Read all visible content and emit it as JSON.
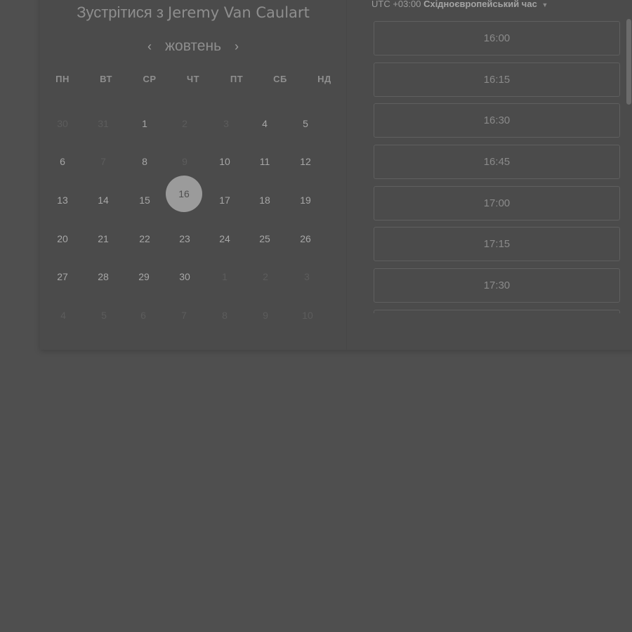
{
  "scheduler": {
    "title_prefix": "Зустрітися з",
    "host_name": "Jeremy Van Caulart",
    "month": "жовтень",
    "prev_icon": "‹",
    "next_icon": "›",
    "weekdays": [
      "ПН",
      "ВТ",
      "СР",
      "ЧТ",
      "ПТ",
      "СБ",
      "НД"
    ],
    "weeks": [
      [
        "30",
        "31",
        "1",
        "2",
        "3",
        "4",
        "5"
      ],
      [
        "6",
        "7",
        "8",
        "9",
        "10",
        "11",
        "12"
      ],
      [
        "13",
        "14",
        "15",
        "16",
        "17",
        "18",
        "19"
      ],
      [
        "20",
        "21",
        "22",
        "23",
        "24",
        "25",
        "26"
      ],
      [
        "27",
        "28",
        "29",
        "30",
        "1",
        "2",
        "3"
      ],
      [
        "4",
        "5",
        "6",
        "7",
        "8",
        "9",
        "10"
      ]
    ],
    "selected_day": "16"
  },
  "timezone": {
    "offset": "UTC +03:00",
    "name": "Східноєвропейський час",
    "caret": "▼"
  },
  "time_slots": [
    "16:00",
    "16:15",
    "16:30",
    "16:45",
    "17:00",
    "17:15",
    "17:30",
    ""
  ]
}
